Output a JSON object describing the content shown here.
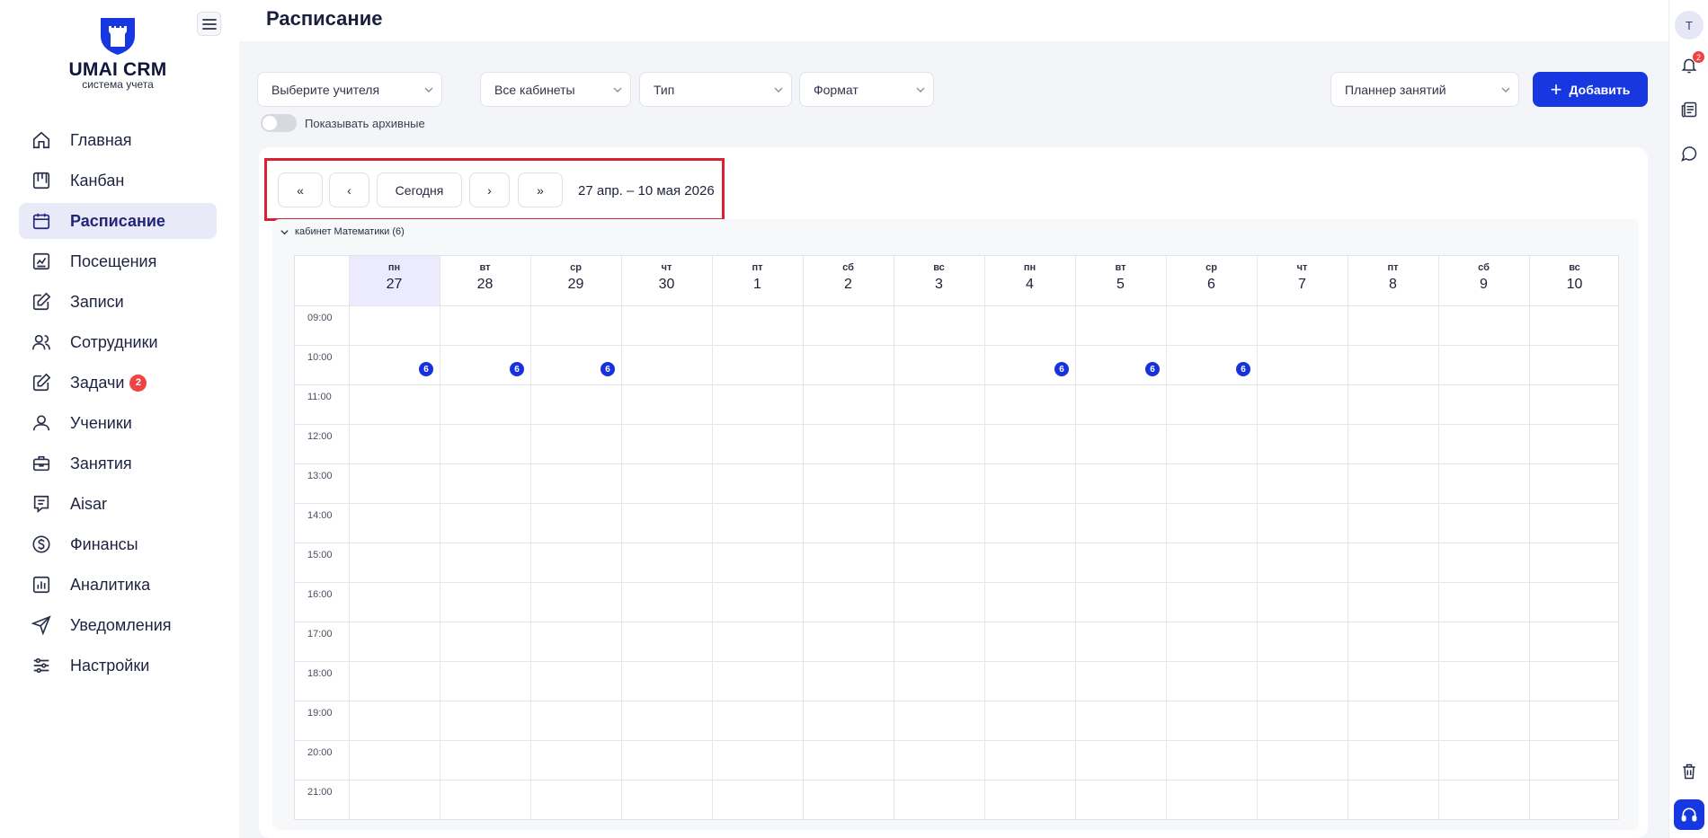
{
  "app": {
    "logo_title": "UMAI CRM",
    "logo_subtitle": "система учета",
    "brand_color": "#1737e0"
  },
  "sidebar": {
    "items": [
      {
        "label": "Главная",
        "icon": "home-icon"
      },
      {
        "label": "Канбан",
        "icon": "kanban-icon"
      },
      {
        "label": "Расписание",
        "icon": "calendar-icon",
        "active": true
      },
      {
        "label": "Посещения",
        "icon": "attendance-chart-icon"
      },
      {
        "label": "Записи",
        "icon": "edit-icon"
      },
      {
        "label": "Сотрудники",
        "icon": "users-icon"
      },
      {
        "label": "Задачи",
        "icon": "task-edit-icon",
        "badge": "2"
      },
      {
        "label": "Ученики",
        "icon": "user-icon"
      },
      {
        "label": "Занятия",
        "icon": "briefcase-icon"
      },
      {
        "label": "Aisar",
        "icon": "chat-icon"
      },
      {
        "label": "Финансы",
        "icon": "dollar-icon"
      },
      {
        "label": "Аналитика",
        "icon": "bar-chart-icon"
      },
      {
        "label": "Уведомления",
        "icon": "send-icon"
      },
      {
        "label": "Настройки",
        "icon": "sliders-icon"
      }
    ]
  },
  "header": {
    "title": "Расписание"
  },
  "filters": {
    "teacher": "Выберите учителя",
    "room": "Все кабинеты",
    "type": "Тип",
    "format": "Формат",
    "planner": "Планнер занятий",
    "add_label": "Добавить",
    "archive_label": "Показывать архивные"
  },
  "calendar_nav": {
    "first": "«",
    "prev": "‹",
    "today": "Сегодня",
    "next": "›",
    "last": "»",
    "range": "27 апр. – 10 мая 2026"
  },
  "room": {
    "label": "кабинет Математики (6)",
    "days": [
      {
        "dow": "пн",
        "num": "27",
        "today": true
      },
      {
        "dow": "вт",
        "num": "28"
      },
      {
        "dow": "ср",
        "num": "29"
      },
      {
        "dow": "чт",
        "num": "30"
      },
      {
        "dow": "пт",
        "num": "1"
      },
      {
        "dow": "сб",
        "num": "2"
      },
      {
        "dow": "вс",
        "num": "3"
      },
      {
        "dow": "пн",
        "num": "4"
      },
      {
        "dow": "вт",
        "num": "5"
      },
      {
        "dow": "ср",
        "num": "6"
      },
      {
        "dow": "чт",
        "num": "7"
      },
      {
        "dow": "пт",
        "num": "8"
      },
      {
        "dow": "сб",
        "num": "9"
      },
      {
        "dow": "вс",
        "num": "10"
      }
    ],
    "times": [
      "09:00",
      "10:00",
      "11:00",
      "12:00",
      "13:00",
      "14:00",
      "15:00",
      "16:00",
      "17:00",
      "18:00",
      "19:00",
      "20:00",
      "21:00"
    ],
    "events": [
      {
        "day": 0,
        "time": "10:00",
        "label": "6"
      },
      {
        "day": 1,
        "time": "10:00",
        "label": "6"
      },
      {
        "day": 2,
        "time": "10:00",
        "label": "6"
      },
      {
        "day": 7,
        "time": "10:00",
        "label": "6"
      },
      {
        "day": 8,
        "time": "10:00",
        "label": "6"
      },
      {
        "day": 9,
        "time": "10:00",
        "label": "6"
      }
    ]
  },
  "rightbar": {
    "avatar": "T",
    "notifications_badge": "2"
  }
}
